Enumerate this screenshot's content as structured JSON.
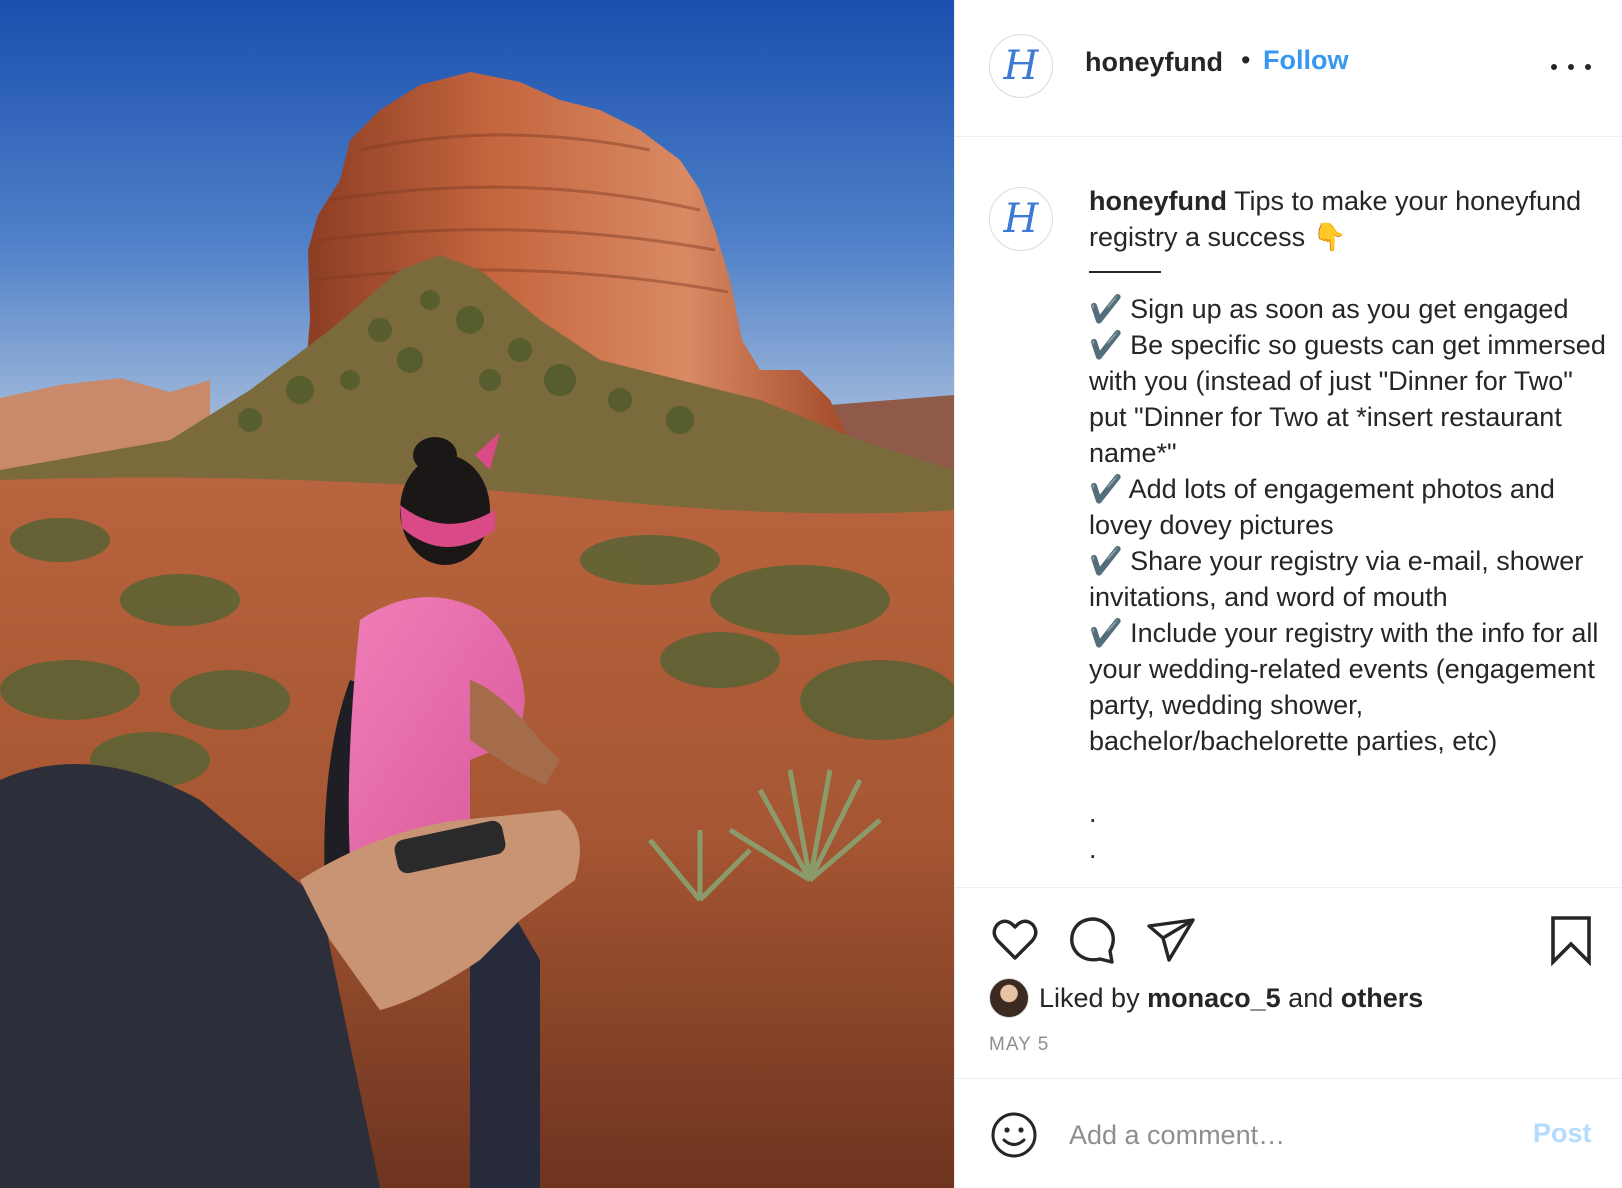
{
  "post": {
    "image": {
      "description_icon": "photo-icon"
    },
    "header": {
      "avatar_letter": "H",
      "username": "honeyfund",
      "separator": "•",
      "follow_label": "Follow",
      "more_icon": "more-options-icon"
    },
    "caption": {
      "avatar_letter": "H",
      "username": "honeyfund",
      "intro": " Tips to make your honeyfund registry a success 👇",
      "body": "✔️ Sign up as soon as you get engaged\n✔️ Be specific so guests can get immersed with you (instead of just \"Dinner for Two\" put \"Dinner for Two at *insert restaurant name*\"\n✔️ Add lots of engagement photos and lovey dovey pictures\n✔️ Share your registry via e-mail, shower invitations, and word of mouth\n✔️ Include your registry with the info for all your wedding-related events (engagement party, wedding shower, bachelor/bachelorette parties, etc)\n\n.\n."
    },
    "actions": {
      "like_icon": "heart-icon",
      "comment_icon": "comment-bubble-icon",
      "share_icon": "paper-plane-icon",
      "save_icon": "bookmark-icon"
    },
    "likes": {
      "prefix": "Liked by",
      "user": "monaco_5",
      "middle": "and",
      "suffix": "others"
    },
    "date": "MAY 5",
    "comment_box": {
      "emoji_icon": "smiley-icon",
      "placeholder": "Add a comment…",
      "value": "",
      "post_label": "Post"
    }
  },
  "colors": {
    "link_blue": "#3897f0",
    "post_disabled": "#b3dbff",
    "text": "#262626",
    "muted": "#8e8e8e",
    "border": "#efefef"
  }
}
